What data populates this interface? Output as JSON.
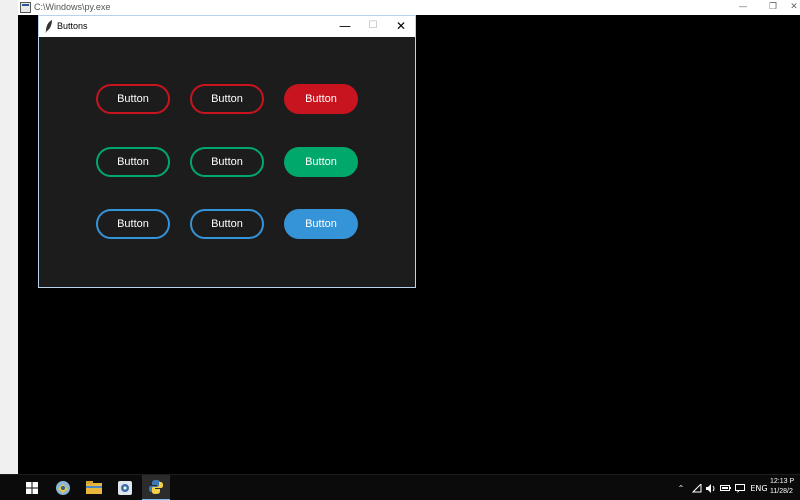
{
  "console_window": {
    "title": "C:\\Windows\\py.exe",
    "controls": {
      "minimize": "—",
      "restore": "❐",
      "close": "✕"
    }
  },
  "tk_window": {
    "title": "Buttons",
    "controls": {
      "minimize": "—",
      "maximize": "☐",
      "close": "✕"
    }
  },
  "buttons": [
    {
      "label": "Button",
      "style": "outline",
      "color": "#c8141e"
    },
    {
      "label": "Button",
      "style": "outline",
      "color": "#c8141e"
    },
    {
      "label": "Button",
      "style": "filled",
      "color": "#c8141e"
    },
    {
      "label": "Button",
      "style": "outline",
      "color": "#00a86b"
    },
    {
      "label": "Button",
      "style": "outline",
      "color": "#00a86b"
    },
    {
      "label": "Button",
      "style": "filled",
      "color": "#00a86b"
    },
    {
      "label": "Button",
      "style": "outline",
      "color": "#3593d8"
    },
    {
      "label": "Button",
      "style": "outline",
      "color": "#3593d8"
    },
    {
      "label": "Button",
      "style": "filled",
      "color": "#3593d8"
    }
  ],
  "taskbar": {
    "apps": [
      "start-icon",
      "python-idle-icon",
      "file-explorer-icon",
      "app-icon",
      "python-icon"
    ],
    "tray": {
      "language": "ENG",
      "time": "12:13 P",
      "date": "11/28/2"
    }
  }
}
